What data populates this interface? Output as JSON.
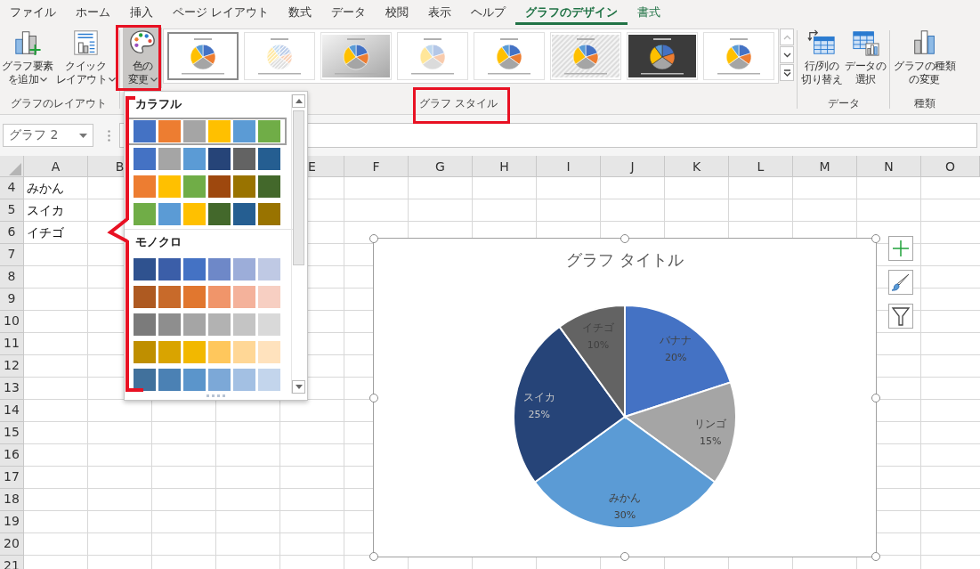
{
  "ribbon": {
    "tabs": [
      {
        "label": "ファイル",
        "selected": false,
        "contextual": false
      },
      {
        "label": "ホーム",
        "selected": false,
        "contextual": false
      },
      {
        "label": "挿入",
        "selected": false,
        "contextual": false
      },
      {
        "label": "ページ レイアウト",
        "selected": false,
        "contextual": false
      },
      {
        "label": "数式",
        "selected": false,
        "contextual": false
      },
      {
        "label": "データ",
        "selected": false,
        "contextual": false
      },
      {
        "label": "校閲",
        "selected": false,
        "contextual": false
      },
      {
        "label": "表示",
        "selected": false,
        "contextual": false
      },
      {
        "label": "ヘルプ",
        "selected": false,
        "contextual": false
      },
      {
        "label": "グラフのデザイン",
        "selected": true,
        "contextual": true
      },
      {
        "label": "書式",
        "selected": false,
        "contextual": true
      }
    ],
    "groups": [
      {
        "kind": "buttons",
        "label": "グラフのレイアウト",
        "buttons": [
          {
            "kind": "add_element",
            "label_lines": [
              "グラフ要素",
              "を追加"
            ],
            "dropdown": true
          },
          {
            "kind": "quick_layout",
            "label_lines": [
              "クイック",
              "レイアウト"
            ],
            "dropdown": true
          }
        ]
      },
      {
        "kind": "styles",
        "label": "グラフ スタイル",
        "color_button": {
          "label_lines": [
            "色の",
            "変更"
          ],
          "dropdown": true,
          "pressed": true
        },
        "styles": [
          {
            "kind": "plain",
            "selected": true
          },
          {
            "kind": "pattern",
            "selected": false
          },
          {
            "kind": "gradient",
            "selected": false
          },
          {
            "kind": "pastel",
            "selected": false
          },
          {
            "kind": "plain",
            "selected": false
          },
          {
            "kind": "striped",
            "selected": false
          },
          {
            "kind": "dark",
            "selected": false
          },
          {
            "kind": "plain",
            "selected": false
          }
        ]
      },
      {
        "kind": "buttons",
        "label": "データ",
        "buttons": [
          {
            "kind": "switch_row_column",
            "label_lines": [
              "行/列の",
              "切り替え"
            ],
            "dropdown": false
          },
          {
            "kind": "select_data",
            "label_lines": [
              "データの",
              "選択"
            ],
            "dropdown": false
          }
        ]
      },
      {
        "kind": "buttons",
        "label": "種類",
        "buttons": [
          {
            "kind": "change_type",
            "label_lines": [
              "グラフの種類",
              "の変更"
            ],
            "dropdown": false
          }
        ]
      }
    ]
  },
  "formula_bar": {
    "name_box": "グラフ 2"
  },
  "sheet": {
    "columns": [
      "A",
      "B",
      null,
      null,
      "E",
      "F",
      "G",
      "H",
      "I",
      "J",
      "K",
      "L",
      "M",
      "N",
      "O"
    ],
    "rows": [
      {
        "number": "4",
        "cells": [
          "みかん"
        ]
      },
      {
        "number": "5",
        "cells": [
          "スイカ"
        ]
      },
      {
        "number": "6",
        "cells": [
          "イチゴ"
        ]
      },
      {
        "number": "7"
      },
      {
        "number": "8"
      },
      {
        "number": "9"
      },
      {
        "number": "10"
      },
      {
        "number": "11"
      },
      {
        "number": "12"
      },
      {
        "number": "13"
      },
      {
        "number": "14"
      },
      {
        "number": "15"
      },
      {
        "number": "16"
      },
      {
        "number": "17"
      },
      {
        "number": "18"
      },
      {
        "number": "19"
      },
      {
        "number": "20"
      },
      {
        "number": "21"
      }
    ]
  },
  "color_menu": {
    "groups": [
      {
        "title": "カラフル",
        "rows": [
          {
            "selected": true,
            "swatches": [
              {
                "color": "#4472c4"
              },
              {
                "color": "#ed7d31"
              },
              {
                "color": "#a5a5a5"
              },
              {
                "color": "#ffc000"
              },
              {
                "color": "#5b9bd5"
              },
              {
                "color": "#70ad47"
              }
            ]
          },
          {
            "selected": false,
            "swatches": [
              {
                "color": "#4472c4"
              },
              {
                "color": "#a5a5a5"
              },
              {
                "color": "#5b9bd5"
              },
              {
                "color": "#264478"
              },
              {
                "color": "#636363"
              },
              {
                "color": "#255e91"
              }
            ]
          },
          {
            "selected": false,
            "swatches": [
              {
                "color": "#ed7d31"
              },
              {
                "color": "#ffc000"
              },
              {
                "color": "#70ad47"
              },
              {
                "color": "#9e480e"
              },
              {
                "color": "#997300"
              },
              {
                "color": "#43682b"
              }
            ]
          },
          {
            "selected": false,
            "swatches": [
              {
                "color": "#70ad47"
              },
              {
                "color": "#5b9bd5"
              },
              {
                "color": "#ffc000"
              },
              {
                "color": "#43682b"
              },
              {
                "color": "#255e91"
              },
              {
                "color": "#997300"
              }
            ]
          }
        ]
      },
      {
        "title": "モノクロ",
        "rows": [
          {
            "selected": false,
            "swatches": [
              {
                "color": "#2f528f"
              },
              {
                "color": "#3b5ea8"
              },
              {
                "color": "#4472c4"
              },
              {
                "color": "#6e88c8"
              },
              {
                "color": "#9cadd9"
              },
              {
                "color": "#bfc9e4"
              }
            ]
          },
          {
            "selected": false,
            "swatches": [
              {
                "color": "#ae5a21"
              },
              {
                "color": "#c86a2a"
              },
              {
                "color": "#e1772f"
              },
              {
                "color": "#f0956a"
              },
              {
                "color": "#f4b29b"
              },
              {
                "color": "#f7cfc2"
              }
            ]
          },
          {
            "selected": false,
            "swatches": [
              {
                "color": "#7b7b7b"
              },
              {
                "color": "#8e8e8e"
              },
              {
                "color": "#a5a5a5"
              },
              {
                "color": "#b2b2b2"
              },
              {
                "color": "#c4c4c4"
              },
              {
                "color": "#d9d9d9"
              }
            ]
          },
          {
            "selected": false,
            "swatches": [
              {
                "color": "#bf8f00"
              },
              {
                "color": "#d9a400"
              },
              {
                "color": "#f2b800"
              },
              {
                "color": "#ffc75c"
              },
              {
                "color": "#ffd796"
              },
              {
                "color": "#ffe2bd"
              }
            ]
          },
          {
            "selected": false,
            "swatches": [
              {
                "color": "#41719c"
              },
              {
                "color": "#4b81b4"
              },
              {
                "color": "#5b95cb"
              },
              {
                "color": "#7ca8d7"
              },
              {
                "color": "#a3c0e3"
              },
              {
                "color": "#c3d5ec"
              }
            ]
          }
        ]
      }
    ]
  },
  "chart": {
    "chart_data": {
      "type": "pie",
      "title": "グラフ タイトル",
      "categories": [
        "バナナ",
        "リンゴ",
        "みかん",
        "スイカ",
        "イチゴ"
      ],
      "values": [
        20,
        15,
        30,
        25,
        10
      ],
      "colors": [
        "#4472c4",
        "#a5a5a5",
        "#5b9bd5",
        "#264478",
        "#636363"
      ],
      "data_labels": true,
      "value_labels": [
        "20%",
        "15%",
        "30%",
        "25%",
        "10%"
      ]
    }
  }
}
